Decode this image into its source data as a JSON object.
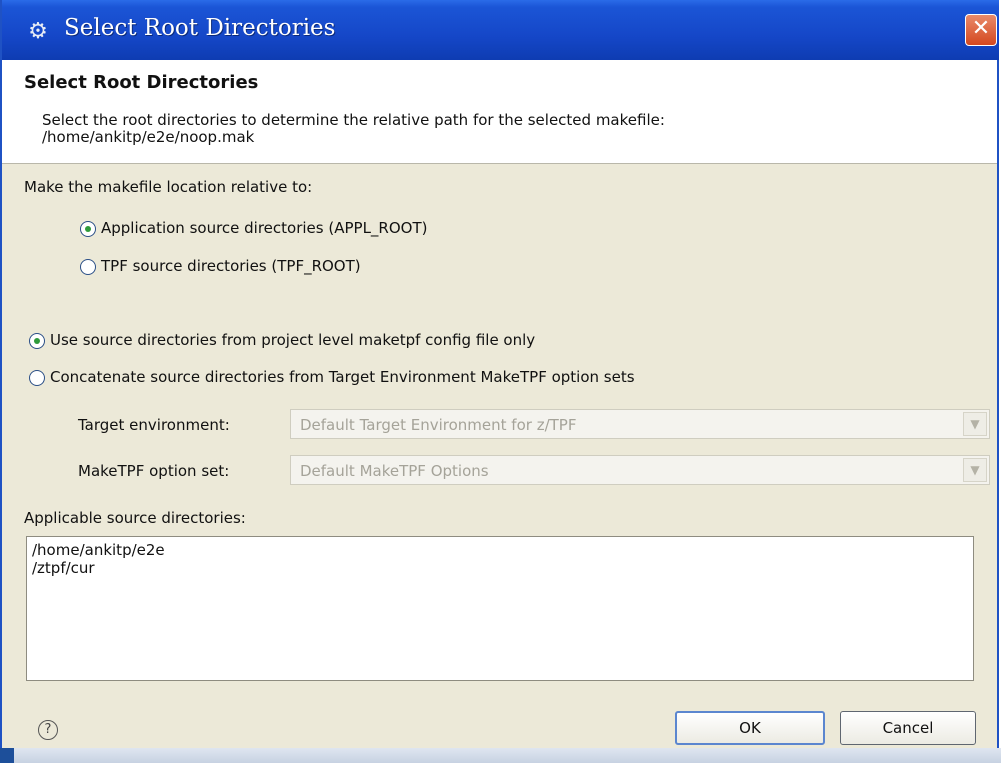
{
  "window": {
    "title": "Select Root Directories",
    "close_symbol": "✕"
  },
  "header": {
    "title": "Select Root Directories",
    "description_line1": "Select the root directories to determine the relative path for the selected makefile:",
    "description_line2": "/home/ankitp/e2e/noop.mak"
  },
  "location": {
    "label": "Make the makefile location relative to:",
    "options": [
      {
        "label": "Application source directories (APPL_ROOT)",
        "selected": true
      },
      {
        "label": "TPF source directories (TPF_ROOT)",
        "selected": false
      }
    ]
  },
  "source_mode": {
    "options": [
      {
        "label": "Use source directories from project level maketpf config file only",
        "selected": true
      },
      {
        "label": "Concatenate source directories from Target Environment MakeTPF option sets",
        "selected": false
      }
    ]
  },
  "target_environment": {
    "label": "Target environment:",
    "value": "Default Target Environment for z/TPF"
  },
  "option_set": {
    "label": "MakeTPF option set:",
    "value": "Default MakeTPF Options"
  },
  "applicable": {
    "label": "Applicable source directories:",
    "items": [
      "/home/ankitp/e2e",
      "/ztpf/cur"
    ]
  },
  "footer": {
    "help_symbol": "?",
    "ok_label": "OK",
    "cancel_label": "Cancel"
  },
  "icons": {
    "app": "gear-icon",
    "close": "close-icon",
    "help": "help-icon",
    "dropdown": "chevron-down-icon"
  },
  "colors": {
    "titlebar": "#1547c8",
    "dialog_background": "#ece9d8",
    "radio_selected": "#2e9a3a",
    "close_button": "#d4481f"
  }
}
